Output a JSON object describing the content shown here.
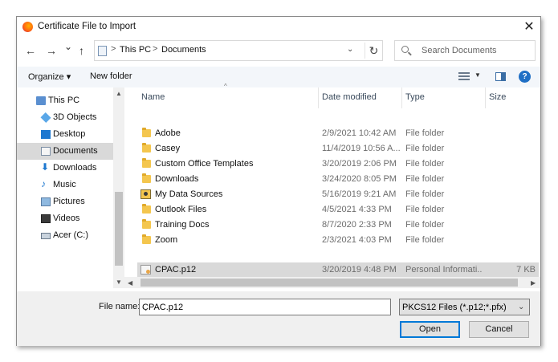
{
  "window": {
    "title": "Certificate File to Import",
    "close_glyph": "✕"
  },
  "nav": {
    "back_glyph": "←",
    "forward_glyph": "→",
    "recent_glyph": "⌄",
    "up_glyph": "↑"
  },
  "address": {
    "crumbs": [
      "This PC",
      "Documents"
    ],
    "separator": ">",
    "refresh_glyph": "↻",
    "dropdown_glyph": "⌄"
  },
  "search": {
    "placeholder": "Search Documents"
  },
  "toolbar": {
    "organize": "Organize ▾",
    "new_folder": "New folder",
    "help": "?"
  },
  "sidebar": {
    "items": [
      {
        "label": "This PC",
        "icon": "pc-icon"
      },
      {
        "label": "3D Objects",
        "icon": "cube-icon"
      },
      {
        "label": "Desktop",
        "icon": "desktop-icon"
      },
      {
        "label": "Documents",
        "icon": "documents-icon",
        "selected": true
      },
      {
        "label": "Downloads",
        "icon": "download-icon"
      },
      {
        "label": "Music",
        "icon": "music-icon"
      },
      {
        "label": "Pictures",
        "icon": "pictures-icon"
      },
      {
        "label": "Videos",
        "icon": "videos-icon"
      },
      {
        "label": "Acer (C:)",
        "icon": "drive-icon"
      }
    ]
  },
  "columns": {
    "name": "Name",
    "date": "Date modified",
    "type": "Type",
    "size": "Size"
  },
  "files": [
    {
      "name": "Adobe",
      "date": "2/9/2021 10:42 AM",
      "type": "File folder",
      "size": "",
      "icon": "folder-icon"
    },
    {
      "name": "Casey",
      "date": "11/4/2019 10:56 A...",
      "type": "File folder",
      "size": "",
      "icon": "folder-icon"
    },
    {
      "name": "Custom Office Templates",
      "date": "3/20/2019 2:06 PM",
      "type": "File folder",
      "size": "",
      "icon": "folder-icon"
    },
    {
      "name": "Downloads",
      "date": "3/24/2020 8:05 PM",
      "type": "File folder",
      "size": "",
      "icon": "folder-icon"
    },
    {
      "name": "My Data Sources",
      "date": "5/16/2019 9:21 AM",
      "type": "File folder",
      "size": "",
      "icon": "datasource-folder-icon"
    },
    {
      "name": "Outlook Files",
      "date": "4/5/2021 4:33 PM",
      "type": "File folder",
      "size": "",
      "icon": "folder-icon"
    },
    {
      "name": "Training Docs",
      "date": "8/7/2020 2:33 PM",
      "type": "File folder",
      "size": "",
      "icon": "folder-icon"
    },
    {
      "name": "Zoom",
      "date": "2/3/2021 4:03 PM",
      "type": "File folder",
      "size": "",
      "icon": "folder-icon"
    },
    {
      "name": "CPAC.p12",
      "date": "3/20/2019 4:48 PM",
      "type": "Personal Informati...",
      "size": "7 KB",
      "icon": "certificate-file-icon",
      "selected": true
    }
  ],
  "bottom": {
    "file_name_label": "File name:",
    "file_name_value": "CPAC.p12",
    "filter_value": "PKCS12 Files (*.p12;*.pfx)",
    "open_label": "Open",
    "cancel_label": "Cancel"
  },
  "colors": {
    "accent": "#0078d7",
    "selection": "#d9d9d9",
    "folder": "#f4c64e",
    "help": "#1f6fc5"
  }
}
